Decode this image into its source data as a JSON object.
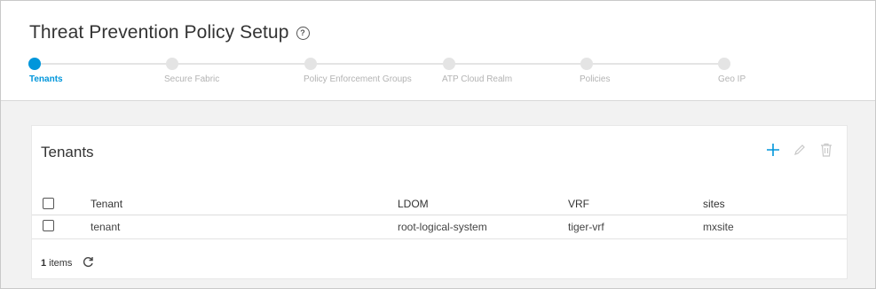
{
  "page": {
    "title": "Threat Prevention Policy Setup"
  },
  "wizard": {
    "steps": [
      {
        "label": "Tenants",
        "active": true
      },
      {
        "label": "Secure Fabric",
        "active": false
      },
      {
        "label": "Policy Enforcement Groups",
        "active": false
      },
      {
        "label": "ATP Cloud Realm",
        "active": false
      },
      {
        "label": "Policies",
        "active": false
      },
      {
        "label": "Geo IP",
        "active": false
      }
    ]
  },
  "card": {
    "title": "Tenants",
    "toolbar": {
      "icons": [
        "add-icon",
        "edit-icon",
        "delete-icon"
      ]
    },
    "columns": [
      "Tenant",
      "LDOM",
      "VRF",
      "sites"
    ],
    "rows": [
      {
        "tenant": "tenant",
        "ldom": "root-logical-system",
        "vrf": "tiger-vrf",
        "sites": "mxsite"
      }
    ],
    "footer": {
      "count": "1",
      "count_label": "items"
    }
  },
  "colors": {
    "accent": "#0096db",
    "inactive": "#e4e4e4",
    "header_bg": "#ffffff",
    "page_bg": "#f2f2f2"
  }
}
